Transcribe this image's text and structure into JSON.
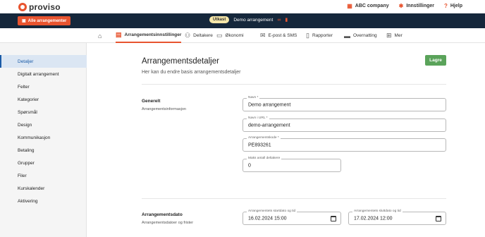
{
  "brand": {
    "logo_text": "proviso",
    "accent": "#e8542f"
  },
  "top_nav": {
    "company": "ABC company",
    "settings": "Innstillinger",
    "help": "Hjelp"
  },
  "event_bar": {
    "all_events_label": "Alle arrangementer",
    "status_badge": "Utkast",
    "event_name": "Demo arrangement"
  },
  "tabs": [
    {
      "label": "",
      "icon": "home-icon"
    },
    {
      "label": "Arrangementsinnstillinger",
      "icon": "calendar-gear-icon"
    },
    {
      "label": "Deltakere",
      "icon": "users-icon"
    },
    {
      "label": "Økonomi",
      "icon": "money-icon"
    },
    {
      "label": "E-post & SMS",
      "icon": "mail-icon"
    },
    {
      "label": "Rapporter",
      "icon": "report-icon"
    },
    {
      "label": "Overnatting",
      "icon": "bed-icon"
    },
    {
      "label": "Mer",
      "icon": "grid-icon"
    }
  ],
  "sidebar": {
    "items": [
      {
        "label": "Detaljer"
      },
      {
        "label": "Digitalt arrangement"
      },
      {
        "label": "Felter"
      },
      {
        "label": "Kategorier"
      },
      {
        "label": "Spørsmål"
      },
      {
        "label": "Design"
      },
      {
        "label": "Kommunikasjon"
      },
      {
        "label": "Betaling"
      },
      {
        "label": "Grupper"
      },
      {
        "label": "Filer"
      },
      {
        "label": "Kurskalender"
      },
      {
        "label": "Aktivering"
      }
    ]
  },
  "main": {
    "title": "Arrangementsdetaljer",
    "subtitle": "Her kan du endre basis arrangementsdetaljer",
    "save_label": "Lagre",
    "general": {
      "title": "Generelt",
      "subtitle": "Arrangementsinformasjon",
      "name_label": "Navn *",
      "name_value": "Demo arrangement",
      "url_label": "Navn i URL *",
      "url_value": "demo-arrangement",
      "code_label": "Arrangementskode *",
      "code_value": "PE893261",
      "max_label": "Maks antall deltakere",
      "max_value": "0"
    },
    "dates": {
      "title": "Arrangementsdato",
      "subtitle": "Arrangementsdatoer og frister",
      "start_label": "Arrangementets startdato og tid",
      "start_value": "16.02.2024 15:00",
      "end_label": "Arrangementets sluttdato og tid",
      "end_value": "17.02.2024 12:00"
    }
  }
}
